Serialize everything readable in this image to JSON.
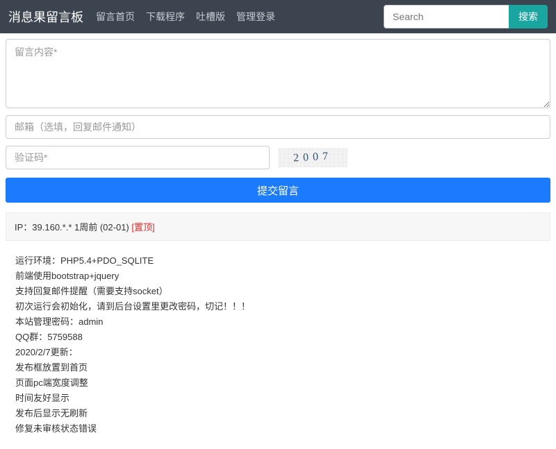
{
  "navbar": {
    "brand": "消息果留言板",
    "links": [
      "留言首页",
      "下载程序",
      "吐槽版",
      "管理登录"
    ],
    "search_placeholder": "Search",
    "search_button": "搜索"
  },
  "form": {
    "content_placeholder": "留言内容*",
    "email_placeholder": "邮箱（选填，回复邮件通知）",
    "captcha_placeholder": "验证码*",
    "captcha_value": "2007",
    "submit_label": "提交留言"
  },
  "post": {
    "meta_prefix": "IP：39.160.*.* 1周前 (02-01) ",
    "pin_label": "[置顶]",
    "lines": [
      "运行环境：PHP5.4+PDO_SQLITE",
      "前端使用bootstrap+jquery",
      "支持回复邮件提醒（需要支持socket）",
      "初次运行会初始化，请到后台设置里更改密码，切记！！！",
      "本站管理密码：admin",
      "QQ群：5759588",
      "2020/2/7更新：",
      "发布框放置到首页",
      "页面pc端宽度调整",
      "时间友好显示",
      "发布后显示无刷新",
      "修复未审核状态错误"
    ]
  }
}
